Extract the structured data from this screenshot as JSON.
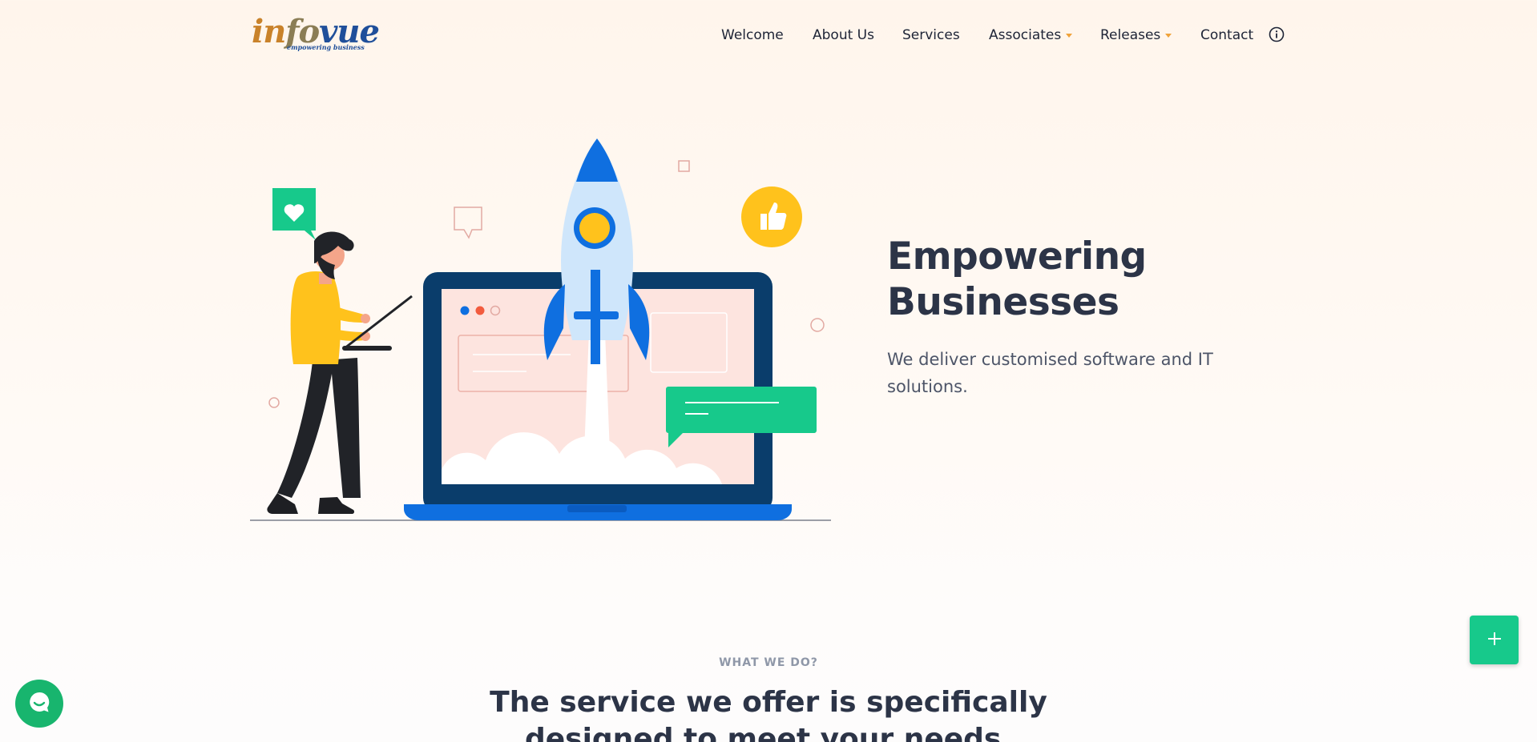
{
  "logo": {
    "word_a": "in",
    "word_b": "fo",
    "word_c": "vue",
    "tagline": "empowering business"
  },
  "nav": {
    "items": [
      {
        "label": "Welcome"
      },
      {
        "label": "About Us"
      },
      {
        "label": "Services"
      },
      {
        "label": "Associates",
        "has_dropdown": true
      },
      {
        "label": "Releases",
        "has_dropdown": true
      },
      {
        "label": "Contact"
      }
    ],
    "info_icon": "info-circle-icon"
  },
  "hero": {
    "title_line1": "Empowering",
    "title_line2": "Businesses",
    "subtitle": "We deliver customised software and IT solutions.",
    "illustration": "rocket-launch-from-laptop-illustration"
  },
  "section": {
    "kicker": "WHAT WE DO?",
    "title": "The service we offer is specifically designed to meet your needs."
  },
  "floating": {
    "fab_icon": "plus-icon",
    "chat_icon": "chat-bubble-icon"
  },
  "colors": {
    "accent_green": "#17c98b",
    "rocket_blue": "#0f6fe0",
    "laptop_navy": "#0a3d6b",
    "yellow": "#ffc21c",
    "caret_orange": "#f0a33a",
    "heading": "#2c3447"
  }
}
